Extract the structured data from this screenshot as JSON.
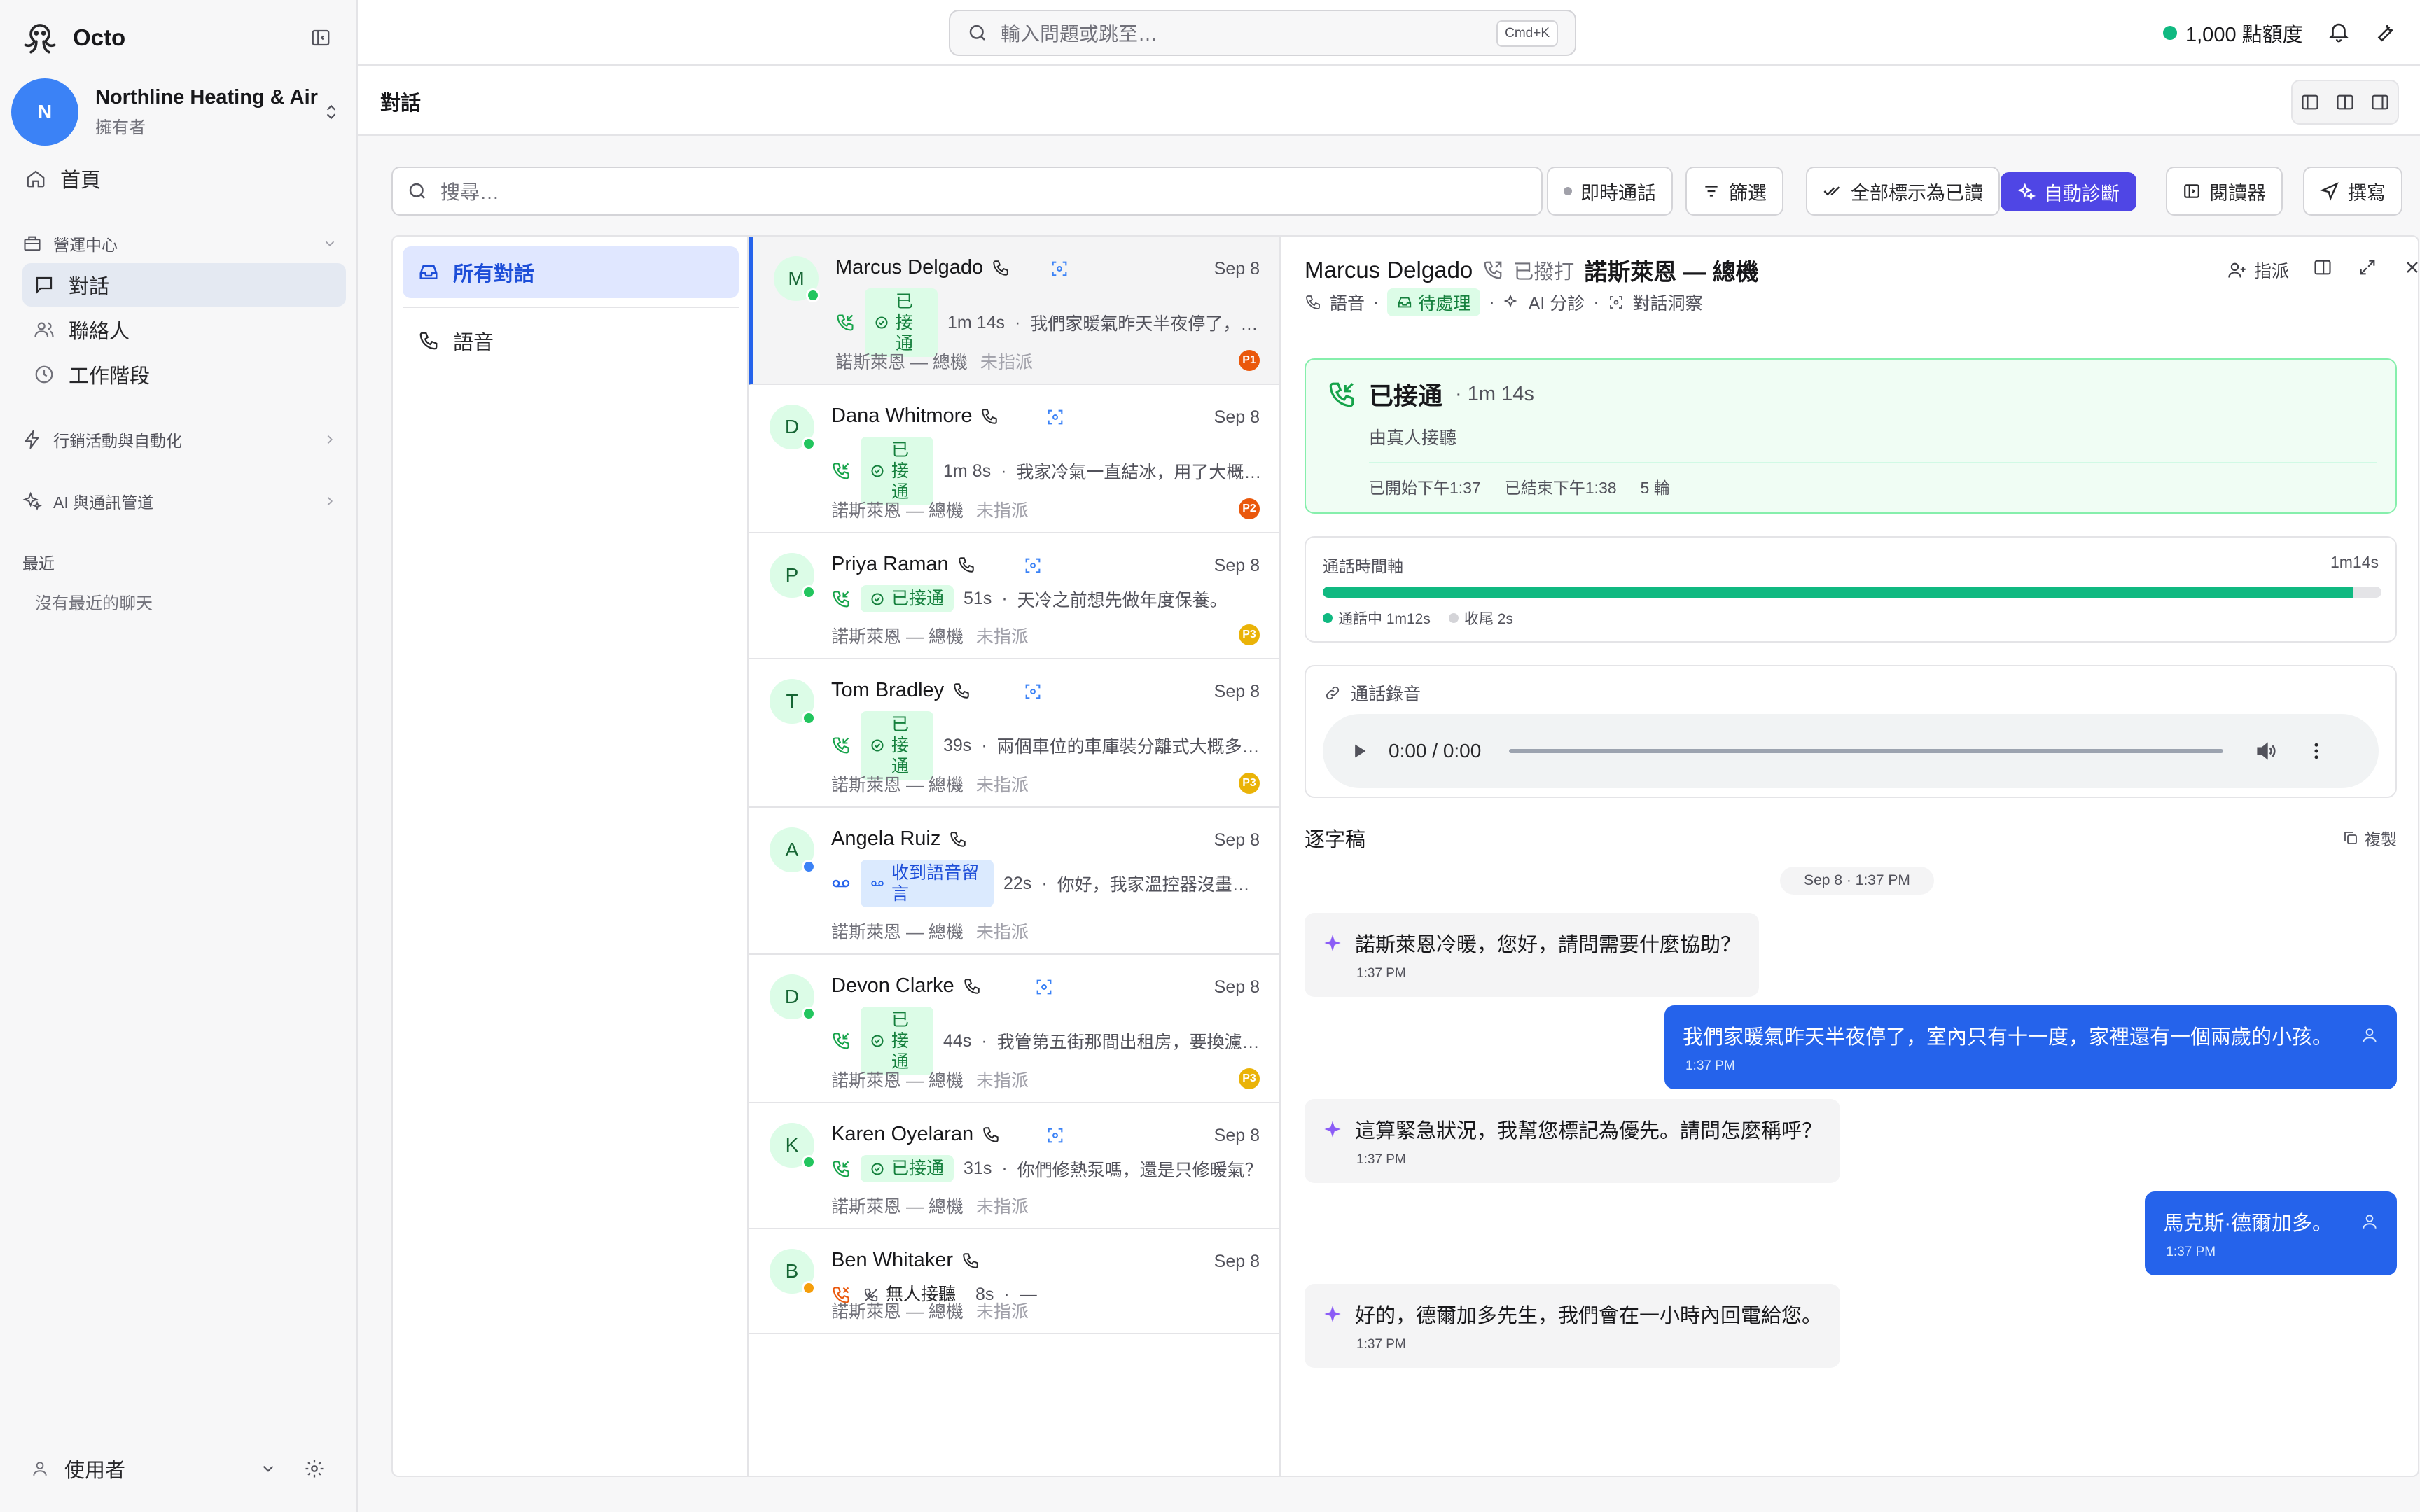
{
  "app": {
    "name": "Octo"
  },
  "org": {
    "initial": "N",
    "name": "Northline Heating & Air",
    "role": "擁有者"
  },
  "nav": {
    "home": "首頁",
    "ops_section": "營運中心",
    "conversations": "對話",
    "contacts": "聯絡人",
    "sessions": "工作階段",
    "marketing_section": "行銷活動與自動化",
    "ai_section": "AI 與通訊管道",
    "recent_heading": "最近",
    "recent_empty": "沒有最近的聊天"
  },
  "user": {
    "label": "使用者"
  },
  "topbar": {
    "search_placeholder": "輸入問題或跳至…",
    "shortcut": "Cmd+K",
    "credits": "1,000 點額度"
  },
  "page": {
    "title": "對話"
  },
  "toolbar": {
    "search_placeholder": "搜尋…",
    "live": "即時通話",
    "filter": "篩選",
    "mark_all_read": "全部標示為已讀",
    "auto_diagnose": "自動診斷",
    "reader": "閱讀器",
    "compose": "撰寫"
  },
  "folders": {
    "all": "所有對話",
    "voice": "語音"
  },
  "conversations": [
    {
      "initial": "M",
      "name": "Marcus Delgado",
      "date": "Sep 8",
      "status": "已接通",
      "duration": "1m 14s",
      "snippet": "我們家暖氣昨天半夜停了，室…",
      "line": "諾斯萊恩 — 總機",
      "assignee": "未指派",
      "priority": "P1",
      "prio_color": "#ea580c",
      "presence": "#22c55e"
    },
    {
      "initial": "D",
      "name": "Dana Whitmore",
      "date": "Sep 8",
      "status": "已接通",
      "duration": "1m 8s",
      "snippet": "我家冷氣一直結冰，用了大概…",
      "line": "諾斯萊恩 — 總機",
      "assignee": "未指派",
      "priority": "P2",
      "prio_color": "#ea580c",
      "presence": "#22c55e"
    },
    {
      "initial": "P",
      "name": "Priya Raman",
      "date": "Sep 8",
      "status": "已接通",
      "duration": "51s",
      "snippet": "天冷之前想先做年度保養。",
      "line": "諾斯萊恩 — 總機",
      "assignee": "未指派",
      "priority": "P3",
      "prio_color": "#eab308",
      "presence": "#22c55e"
    },
    {
      "initial": "T",
      "name": "Tom Bradley",
      "date": "Sep 8",
      "status": "已接通",
      "duration": "39s",
      "snippet": "兩個車位的車庫裝分離式大概多…",
      "line": "諾斯萊恩 — 總機",
      "assignee": "未指派",
      "priority": "P3",
      "prio_color": "#eab308",
      "presence": "#22c55e"
    },
    {
      "initial": "A",
      "name": "Angela Ruiz",
      "date": "Sep 8",
      "status": "收到語音留言",
      "duration": "22s",
      "snippet": "你好，我家溫控器沒畫面…",
      "line": "諾斯萊恩 — 總機",
      "assignee": "未指派",
      "priority": "",
      "prio_color": "",
      "presence": "#3b82f6"
    },
    {
      "initial": "D",
      "name": "Devon Clarke",
      "date": "Sep 8",
      "status": "已接通",
      "duration": "44s",
      "snippet": "我管第五街那間出租房，要換濾…",
      "line": "諾斯萊恩 — 總機",
      "assignee": "未指派",
      "priority": "P3",
      "prio_color": "#eab308",
      "presence": "#22c55e"
    },
    {
      "initial": "K",
      "name": "Karen Oyelaran",
      "date": "Sep 8",
      "status": "已接通",
      "duration": "31s",
      "snippet": "你們修熱泵嗎，還是只修暖氣？",
      "line": "諾斯萊恩 — 總機",
      "assignee": "未指派",
      "priority": "",
      "prio_color": "",
      "presence": "#22c55e"
    },
    {
      "initial": "B",
      "name": "Ben Whitaker",
      "date": "Sep 8",
      "status": "無人接聽",
      "duration": "8s",
      "snippet": "—",
      "line": "諾斯萊恩 — 總機",
      "assignee": "未指派",
      "priority": "",
      "prio_color": "",
      "presence": "#f59e0b"
    }
  ],
  "detail": {
    "name": "Marcus Delgado",
    "direction": "已撥打",
    "line": "諾斯萊恩 — 總機",
    "channel": "語音",
    "state": "待處理",
    "ai_triage": "AI 分診",
    "insights": "對話洞察",
    "assign": "指派",
    "call": {
      "status": "已接通",
      "duration": "· 1m 14s",
      "answered_by": "由真人接聽",
      "started": "已開始下午1:37",
      "ended": "已結束下午1:38",
      "turns": "5 輪"
    },
    "timeline": {
      "title": "通話時間軸",
      "total": "1m14s",
      "talk_label": "通話中 1m12s",
      "wrap_label": "收尾 2s",
      "talk_fraction": 0.973
    },
    "recording": {
      "title": "通話錄音",
      "time": "0:00 / 0:00"
    },
    "transcript": {
      "title": "逐字稿",
      "copy": "複製",
      "date": "Sep 8 · 1:37 PM",
      "messages": [
        {
          "role": "ai",
          "text": "諾斯萊恩冷暖，您好，請問需要什麼協助？",
          "time": "1:37 PM"
        },
        {
          "role": "caller",
          "text": "我們家暖氣昨天半夜停了，室內只有十一度，家裡還有一個兩歲的小孩。",
          "time": "1:37 PM"
        },
        {
          "role": "ai",
          "text": "這算緊急狀況，我幫您標記為優先。請問怎麼稱呼？",
          "time": "1:37 PM"
        },
        {
          "role": "caller",
          "text": "馬克斯·德爾加多。",
          "time": "1:37 PM"
        },
        {
          "role": "ai",
          "text": "好的，德爾加多先生，我們會在一小時內回電給您。",
          "time": "1:37 PM"
        }
      ]
    }
  },
  "colors": {
    "accent": "#2563eb",
    "primary_button": "#4f46e5",
    "success": "#10b981"
  }
}
